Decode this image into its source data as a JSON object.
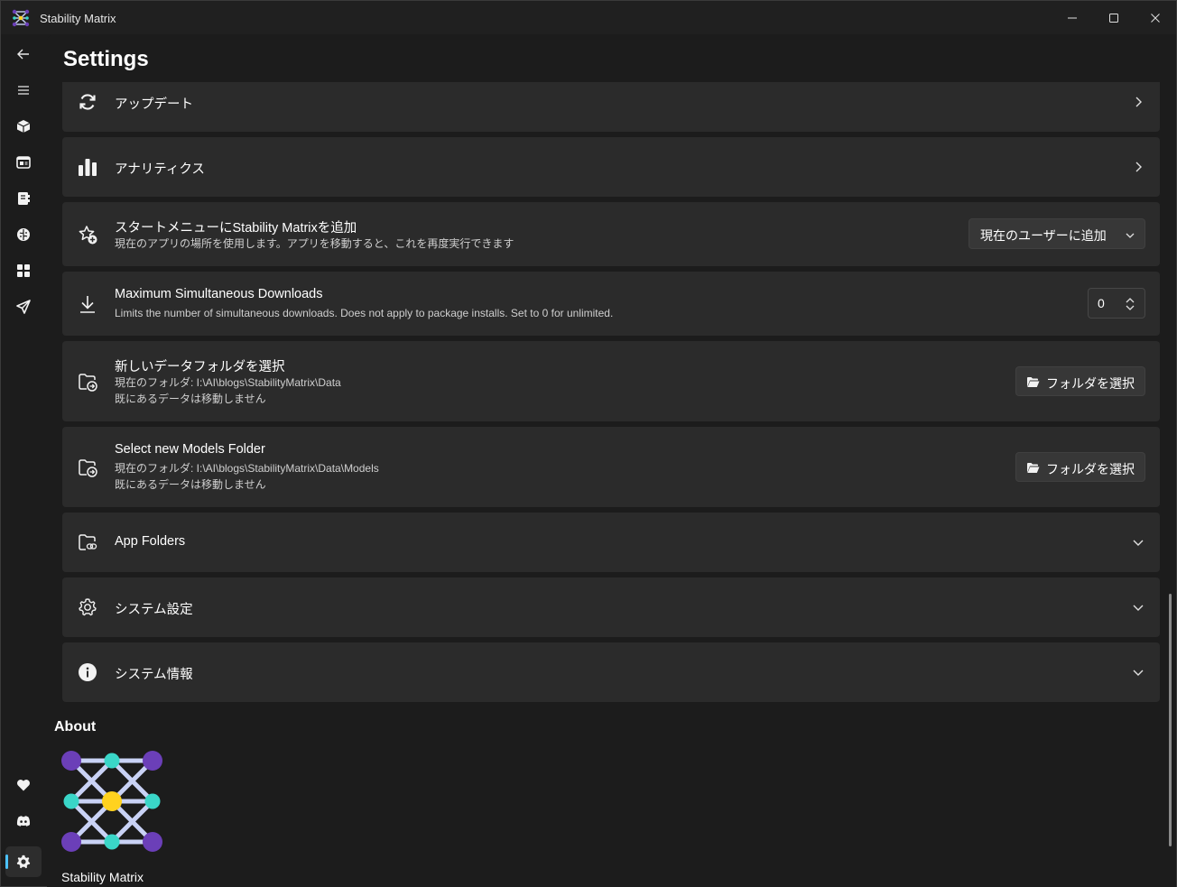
{
  "window": {
    "title": "Stability Matrix"
  },
  "page": {
    "title": "Settings"
  },
  "sidebar": {
    "items": [
      {
        "name": "back",
        "icon": "back-arrow-icon"
      },
      {
        "name": "menu",
        "icon": "hamburger-menu-icon"
      },
      {
        "name": "packages",
        "icon": "package-box-icon"
      },
      {
        "name": "inference",
        "icon": "app-window-icon"
      },
      {
        "name": "checkpoints",
        "icon": "notebook-icon"
      },
      {
        "name": "model-browser",
        "icon": "brain-icon"
      },
      {
        "name": "outputs",
        "icon": "grid-apps-icon"
      },
      {
        "name": "workflows",
        "icon": "send-icon"
      },
      {
        "name": "patreon",
        "icon": "heart-icon"
      },
      {
        "name": "discord",
        "icon": "discord-icon"
      },
      {
        "name": "settings",
        "icon": "gear-icon",
        "active": true
      }
    ]
  },
  "settings": {
    "updates": {
      "title": "アップデート"
    },
    "analytics": {
      "title": "アナリティクス"
    },
    "start_menu": {
      "title": "スタートメニューにStability Matrixを追加",
      "description": "現在のアプリの場所を使用します。アプリを移動すると、これを再度実行できます",
      "dropdown_value": "現在のユーザーに追加"
    },
    "max_downloads": {
      "title": "Maximum Simultaneous Downloads",
      "description": "Limits the number of simultaneous downloads. Does not apply to package installs. Set to 0 for unlimited.",
      "value": "0"
    },
    "data_folder": {
      "title": "新しいデータフォルダを選択",
      "current": "現在のフォルダ: I:\\AI\\blogs\\StabilityMatrix\\Data",
      "note": "既にあるデータは移動しません",
      "button": "フォルダを選択"
    },
    "models_folder": {
      "title": "Select new Models Folder",
      "current": "現在のフォルダ: I:\\AI\\blogs\\StabilityMatrix\\Data\\Models",
      "note": "既にあるデータは移動しません",
      "button": "フォルダを選択"
    },
    "app_folders": {
      "title": "App Folders"
    },
    "system_settings": {
      "title": "システム設定"
    },
    "system_info": {
      "title": "システム情報"
    }
  },
  "about": {
    "heading": "About",
    "app_name": "Stability Matrix"
  },
  "colors": {
    "accent": "#4cc2ff",
    "logo_purple": "#6b3fb8",
    "logo_teal": "#3ad6c8",
    "logo_yellow": "#ffd21f",
    "logo_lines": "#c9d2f5"
  }
}
